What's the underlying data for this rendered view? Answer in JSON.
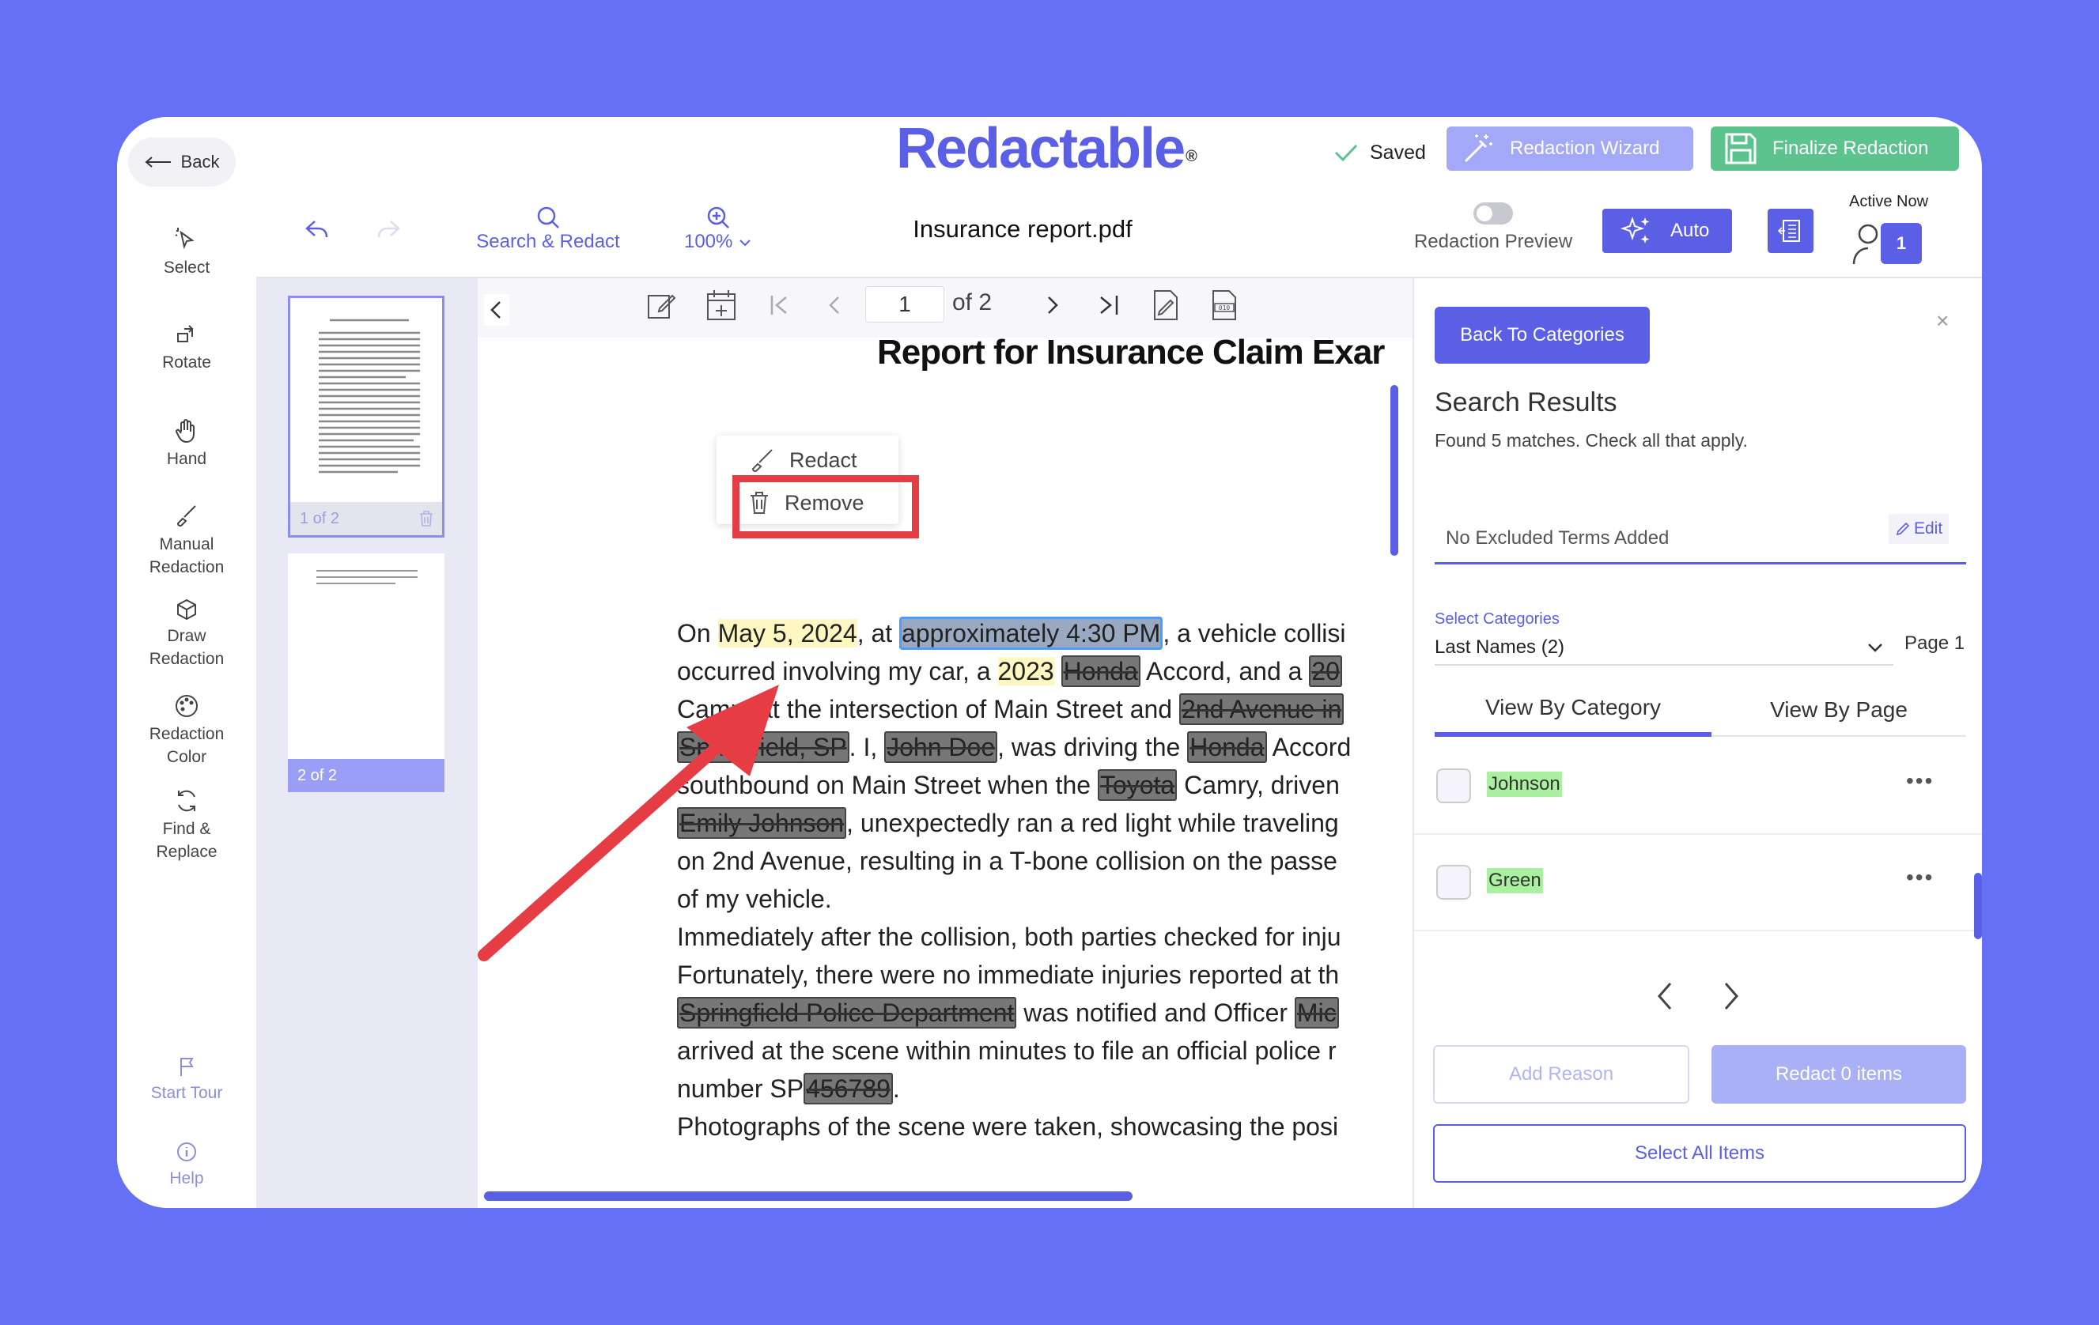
{
  "app": {
    "name": "Redactable",
    "logo_mark": "®"
  },
  "header": {
    "back_label": "Back",
    "saved_label": "Saved",
    "wizard_label": "Redaction Wizard",
    "finalize_label": "Finalize Redaction"
  },
  "toolbar": {
    "search_label": "Search & Redact",
    "zoom_label": "100%",
    "doc_title": "Insurance report.pdf",
    "preview_label": "Redaction Preview",
    "auto_label": "Auto",
    "active_now_label": "Active Now",
    "active_count": "1"
  },
  "tools": [
    {
      "label": "Select"
    },
    {
      "label": "Rotate"
    },
    {
      "label": "Hand"
    },
    {
      "label": "Manual Redaction"
    },
    {
      "label": "Draw Redaction"
    },
    {
      "label": "Redaction Color"
    },
    {
      "label": "Find & Replace"
    },
    {
      "label": "Start Tour"
    },
    {
      "label": "Help"
    }
  ],
  "thumbs": [
    {
      "label": "1 of 2"
    },
    {
      "label": "2 of 2"
    }
  ],
  "pager": {
    "page": "1",
    "of_label": "of 2"
  },
  "doc": {
    "heading": "Report for Insurance Claim Exar",
    "lines": [
      [
        "On ",
        "May 5, 2024",
        ", at ",
        "approximately 4:30 PM",
        ", a vehicle collisi"
      ],
      [
        "occurred involving my car, a ",
        "2023",
        " ",
        "Honda",
        " Accord, and a ",
        "20"
      ],
      [
        "Camry at the intersection of Main Street and ",
        "2nd Avenue in"
      ],
      [
        "Springfield, SP",
        ". I, ",
        "John Doe",
        ", was driving the ",
        "Honda",
        " Accord"
      ],
      [
        "southbound on Main Street when the ",
        "Toyota",
        " Camry, driven"
      ],
      [
        "Emily Johnson",
        ", unexpectedly ran a red light while traveling"
      ],
      [
        "on 2nd Avenue, resulting in a T-bone collision on the passe"
      ],
      [
        "of my vehicle."
      ],
      [
        "Immediately after the collision, both parties checked for inju"
      ],
      [
        "Fortunately, there were no immediate injuries reported at th"
      ],
      [
        "Springfield Police Department",
        " was notified and Officer ",
        "Mic"
      ],
      [
        "arrived at the scene within minutes to file an official police r"
      ],
      [
        "number SP",
        "456789",
        "."
      ],
      [
        "Photographs of the scene were taken, showcasing the posi"
      ]
    ]
  },
  "context_menu": {
    "redact_label": "Redact",
    "remove_label": "Remove"
  },
  "panel": {
    "back_label": "Back To Categories",
    "close_label": "×",
    "title": "Search Results",
    "subtitle": "Found 5 matches. Check all that apply.",
    "excluded_label": "No Excluded Terms Added",
    "edit_label": "Edit",
    "category_caption": "Select Categories",
    "category_value": "Last Names (2)",
    "page_label": "Page 1",
    "tab_category": "View By Category",
    "tab_page": "View By Page",
    "results": [
      {
        "term": "Johnson"
      },
      {
        "term": "Green"
      }
    ],
    "more_label": "•••",
    "add_reason_label": "Add Reason",
    "redact_items_label": "Redact 0 items",
    "select_all_label": "Select All Items"
  },
  "colors": {
    "accent": "#5a5fe6",
    "background": "#6670f7",
    "finalize": "#5cc28e",
    "arrow": "#e63d45"
  }
}
